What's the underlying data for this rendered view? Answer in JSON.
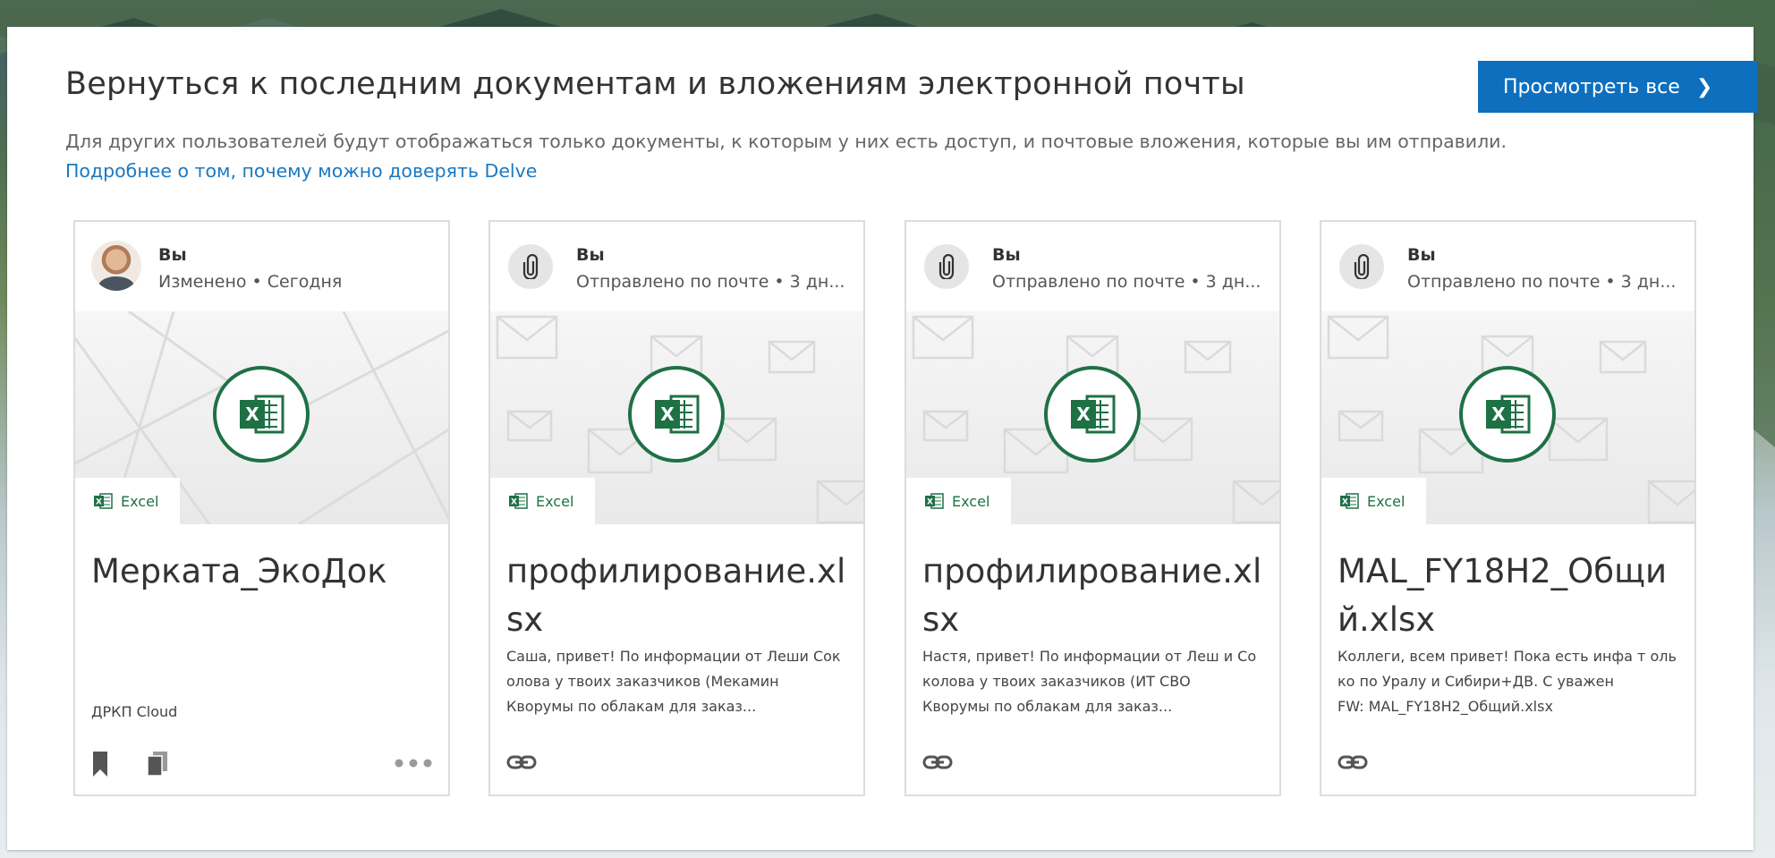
{
  "section": {
    "title": "Вернуться к последним документам и вложениям электронной почты",
    "view_all_label": "Просмотреть все",
    "description": "Для других пользователей будут отображаться только документы, к которым у них есть доступ, и почтовые вложения, которые вы им отправили.",
    "learn_more_link": "Подробнее о том, почему можно доверять Delve"
  },
  "colors": {
    "accent": "#0d6fbe",
    "link": "#1979c3",
    "excel_green": "#1e7145"
  },
  "cards": [
    {
      "author": "Вы",
      "meta": "Изменено • Сегодня",
      "app": "Excel",
      "title": "Мерката_ЭкоДок",
      "source": "ДРКП Cloud",
      "icons": [
        "avatar",
        "excel-icon",
        "bookmark-icon",
        "copy-icon",
        "more-icon"
      ]
    },
    {
      "author": "Вы",
      "meta": "Отправлено по почте • 3 дн...",
      "app": "Excel",
      "title": "профилирование.xlsx",
      "preview": "Саша, привет! По информации от Леши Соколова у твоих заказчиков (Мекамин",
      "source": "Кворумы по облакам для заказ...",
      "icons": [
        "paperclip-icon",
        "excel-icon",
        "link-icon"
      ]
    },
    {
      "author": "Вы",
      "meta": "Отправлено по почте • 3 дн...",
      "app": "Excel",
      "title": "профилирование.xlsx",
      "preview": "Настя, привет! По информации от Леш и Соколова у твоих заказчиков (ИТ СВО",
      "source": "Кворумы по облакам для заказ...",
      "icons": [
        "paperclip-icon",
        "excel-icon",
        "link-icon"
      ]
    },
    {
      "author": "Вы",
      "meta": "Отправлено по почте • 3 дн...",
      "app": "Excel",
      "title": "MAL_FY18H2_Общий.xlsx",
      "preview": "Коллеги, всем привет! Пока есть инфа т олько по Уралу и Сибири+ДВ. С уважен",
      "source": "FW: MAL_FY18H2_Общий.xlsx",
      "icons": [
        "paperclip-icon",
        "excel-icon",
        "link-icon"
      ]
    }
  ]
}
